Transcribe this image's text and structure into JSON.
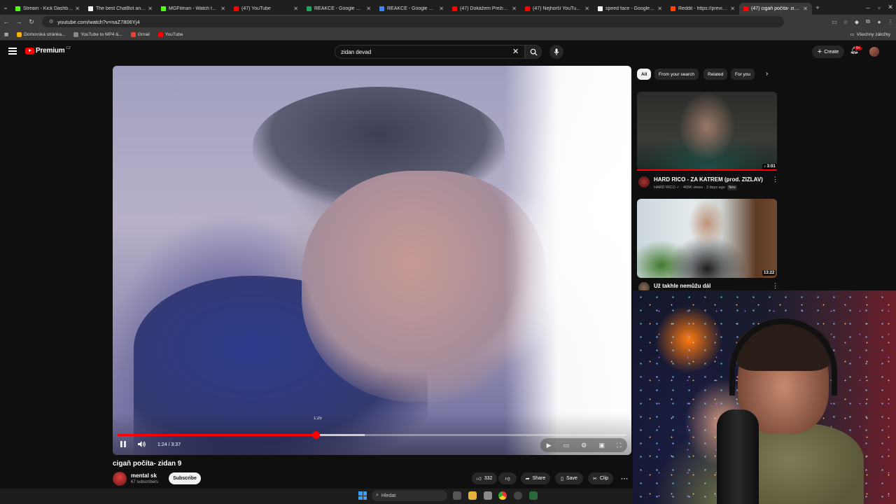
{
  "browser": {
    "tabs": [
      {
        "title": "Stream - Kick Dashboard",
        "color": "#53fc18"
      },
      {
        "title": "The best ChatBot and Wi...",
        "color": "#ffffff"
      },
      {
        "title": "MGFilman - Watch the V...",
        "color": "#53fc18"
      },
      {
        "title": "(47) YouTube",
        "color": "#ff0000"
      },
      {
        "title": "REAKCE - Google Drive",
        "color": "#1fa463"
      },
      {
        "title": "REAKCE - Google Docs",
        "color": "#4285f4"
      },
      {
        "title": "(47) Dokážem PrežiŤ 24 H...",
        "color": "#ff0000"
      },
      {
        "title": "(47) Nejhorší YouTube Ka...",
        "color": "#ff0000"
      },
      {
        "title": "speed face - Google Sear...",
        "color": "#ffffff"
      },
      {
        "title": "Reddit - https://preview.r...",
        "color": "#ff4500"
      },
      {
        "title": "(47) cigaň počíta- zida...",
        "color": "#ff0000",
        "active": true
      }
    ],
    "url": "youtube.com/watch?v=naZ7806Yj4",
    "bookmarks": [
      {
        "label": "Domovská stránka...",
        "color": "#f4b400"
      },
      {
        "label": "YouTube to MP4 &...",
        "color": "#888888"
      },
      {
        "label": "Gmail",
        "color": "#ea4335"
      },
      {
        "label": "YouTube",
        "color": "#ff0000"
      }
    ],
    "all_bookmarks": "Všechny záložky"
  },
  "header": {
    "logo_text": "Premium",
    "region": "CZ",
    "search_value": "zidan devad",
    "create_label": "Create",
    "notif_count": "9+"
  },
  "player": {
    "hover_time": "1:25",
    "current": "1:24",
    "duration": "3:37",
    "time_display": "1:24 / 3:37",
    "progress": 0.39,
    "buffered": 0.485
  },
  "video": {
    "title": "cigaň počíta- zidan 9",
    "channel": "mental sk",
    "subscribers": "67 subscribers",
    "subscribe_label": "Subscribe",
    "likes": "332",
    "share_label": "Share",
    "save_label": "Save",
    "clip_label": "Clip"
  },
  "chips": [
    "All",
    "From your search",
    "Related",
    "For you"
  ],
  "related": [
    {
      "title": "HARD RICO - ZA KATREM (prod. ZIZLAV)",
      "channel": "HARD RICO",
      "meta": "HARD RICO ✓ · 465K views · 3 days ago",
      "badge": "New",
      "duration": "3:01"
    },
    {
      "title": "Už takhle nemůžu dál",
      "duration": "13:22"
    }
  ],
  "taskbar": {
    "search_placeholder": "Hledat"
  }
}
